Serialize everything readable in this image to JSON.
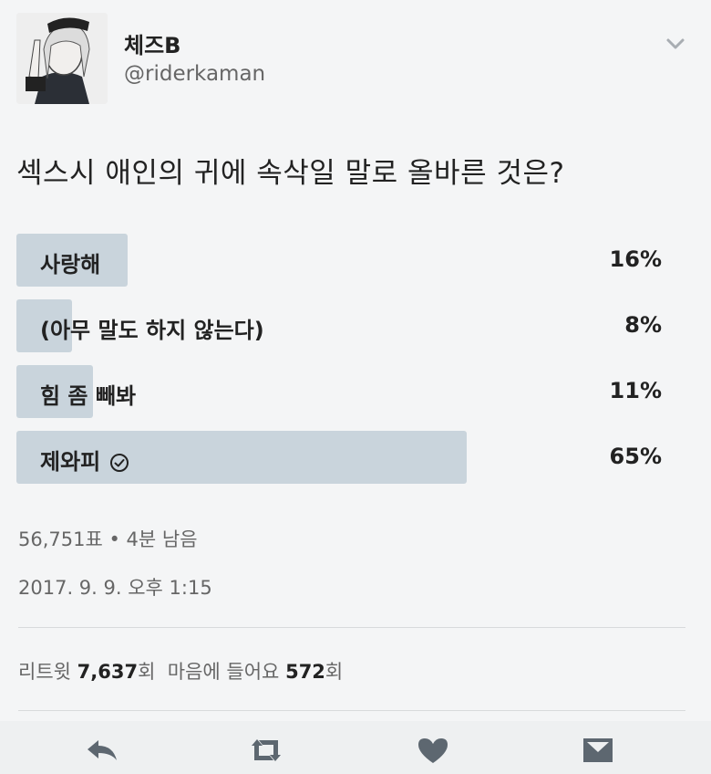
{
  "tweet": {
    "display_name": "체즈B",
    "handle": "@riderkaman",
    "text": "섹스시 애인의 귀에 속삭일 말로 올바른 것은?"
  },
  "poll": {
    "choices": [
      {
        "label": "사랑해",
        "percent_text": "16%",
        "percent": 16,
        "selected": false
      },
      {
        "label": "(아무 말도 하지 않는다)",
        "percent_text": "8%",
        "percent": 8,
        "selected": false
      },
      {
        "label": "힘 좀 빼봐",
        "percent_text": "11%",
        "percent": 11,
        "selected": false
      },
      {
        "label": "제와피",
        "percent_text": "65%",
        "percent": 65,
        "selected": true
      }
    ],
    "votes_info": "56,751표 • 4분 남음"
  },
  "timestamp": "2017. 9. 9. 오후 1:15",
  "stats": {
    "retweets_label": "리트윗",
    "retweets": "7,637",
    "retweets_suffix": "회",
    "likes_label": "마음에 들어요",
    "likes": "572",
    "likes_suffix": "회"
  },
  "icons": [
    "chevron-down-icon",
    "check-circle-icon",
    "reply-icon",
    "retweet-icon",
    "heart-icon",
    "dm-icon"
  ],
  "colors": {
    "bar": "#c9d4dc",
    "icon": "#5d6770",
    "text_secondary": "#666666"
  }
}
